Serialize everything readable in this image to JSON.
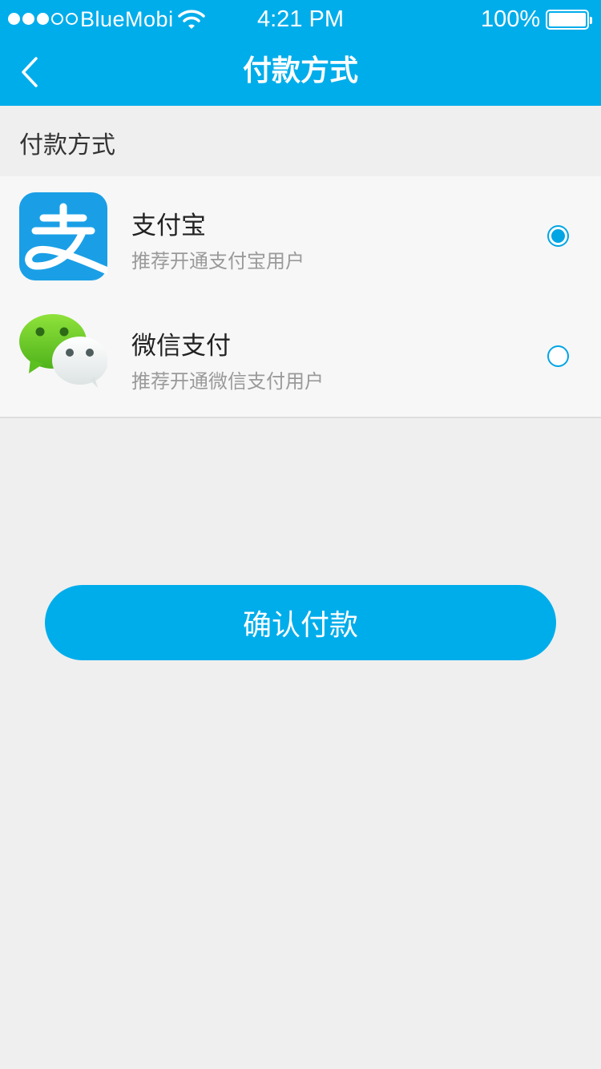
{
  "status_bar": {
    "carrier": "BlueMobi",
    "time": "4:21 PM",
    "battery": "100%",
    "signal_bars_filled": 3,
    "signal_bars_total": 5
  },
  "nav": {
    "title": "付款方式",
    "back_icon": "chevron-left-icon"
  },
  "section": {
    "label": "付款方式"
  },
  "payment_methods": [
    {
      "name": "支付宝",
      "description": "推荐开通支付宝用户",
      "icon": "alipay-icon",
      "selected": true
    },
    {
      "name": "微信支付",
      "description": "推荐开通微信支付用户",
      "icon": "wechat-icon",
      "selected": false
    }
  ],
  "confirm_button": {
    "label": "确认付款"
  },
  "colors": {
    "primary": "#00adeb",
    "background": "#efefef",
    "alipay": "#1a9fe6",
    "wechat": "#7bd02a"
  }
}
